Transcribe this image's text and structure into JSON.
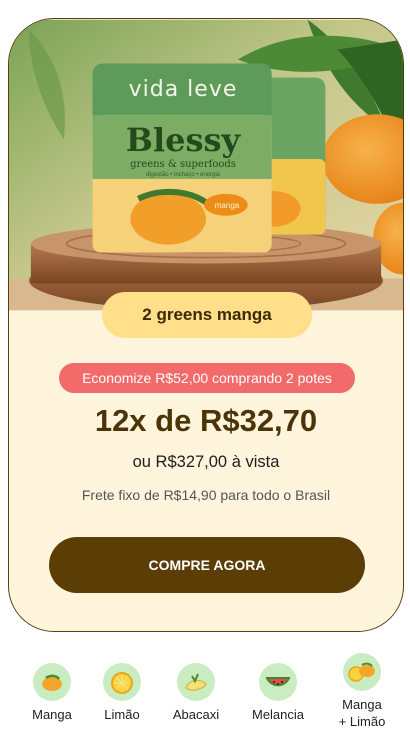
{
  "hero": {
    "brand": "vida leve",
    "product_name": "Blessy",
    "product_subtitle": "greens & superfoods",
    "product_tagline": "digestão • inchaço • energia",
    "flavor_tag": "manga"
  },
  "offer": {
    "product_badge": "2 greens manga",
    "savings": "Economize R$52,00 comprando 2 potes",
    "installments": "12x de R$32,70",
    "cash_price": "ou R$327,00 à vista",
    "shipping": "Frete fixo de R$14,90 para todo o Brasil",
    "cta": "COMPRE AGORA"
  },
  "flavors": [
    {
      "label": "Manga",
      "icon": "mango-icon"
    },
    {
      "label": "Limão",
      "icon": "lemon-icon"
    },
    {
      "label": "Abacaxi",
      "icon": "pineapple-icon"
    },
    {
      "label": "Melancia",
      "icon": "watermelon-icon"
    },
    {
      "label": "Manga\n+ Limão",
      "icon": "mango-lemon-icon"
    }
  ],
  "colors": {
    "accent_brown": "#5b3e06",
    "badge_yellow": "#ffdf8a",
    "savings_red": "#f26a6a",
    "card_bg": "#fff5dc",
    "jar_green": "#5e9a5a"
  }
}
